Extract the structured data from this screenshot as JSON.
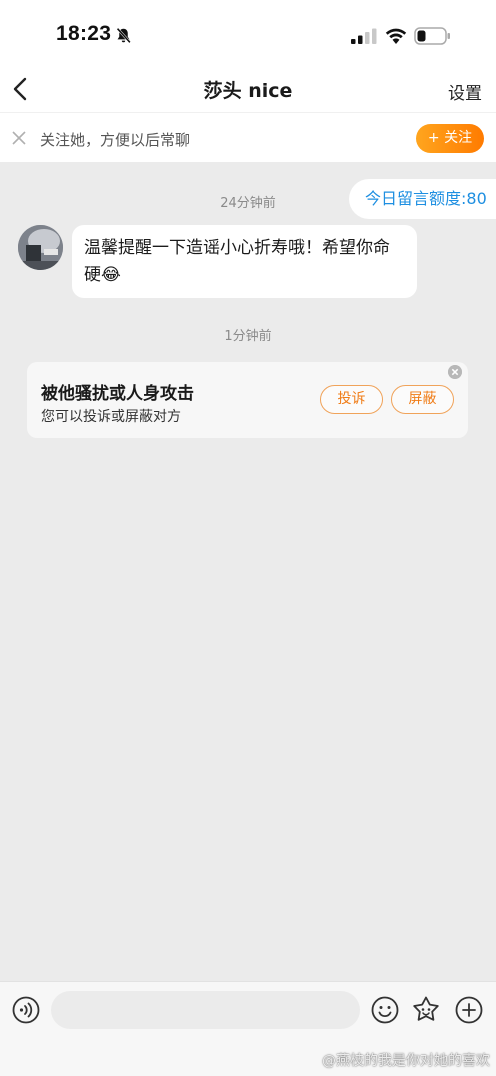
{
  "status_bar": {
    "time": "18:23",
    "icons": [
      "bell-off-icon",
      "cellular-signal-icon",
      "wifi-icon",
      "battery-icon"
    ]
  },
  "nav": {
    "back_icon": "chevron-left-icon",
    "title": "莎头 nice",
    "settings_label": "设置"
  },
  "follow_banner": {
    "close_icon": "close-icon",
    "text": "关注她，方便以后常聊",
    "button_label": "+ 关注",
    "button_color": "#ff8a00"
  },
  "quota": {
    "label": "今日留言额度:80",
    "color": "#1e8fe1"
  },
  "messages": [
    {
      "timestamp": "24分钟前",
      "text": "温馨提醒一下造谣小心折寿哦！希望你命硬😂"
    }
  ],
  "report_card": {
    "timestamp": "1分钟前",
    "title": "被他骚扰或人身攻击",
    "subtitle": "您可以投诉或屏蔽对方",
    "complain_label": "投诉",
    "block_label": "屏蔽",
    "accent_color": "#f07d18"
  },
  "input_bar": {
    "placeholder": "",
    "icons": [
      "voice-icon",
      "emoji-icon",
      "sticker-icon",
      "plus-icon"
    ]
  },
  "watermark": "@燕枝的我是你对她的喜欢"
}
